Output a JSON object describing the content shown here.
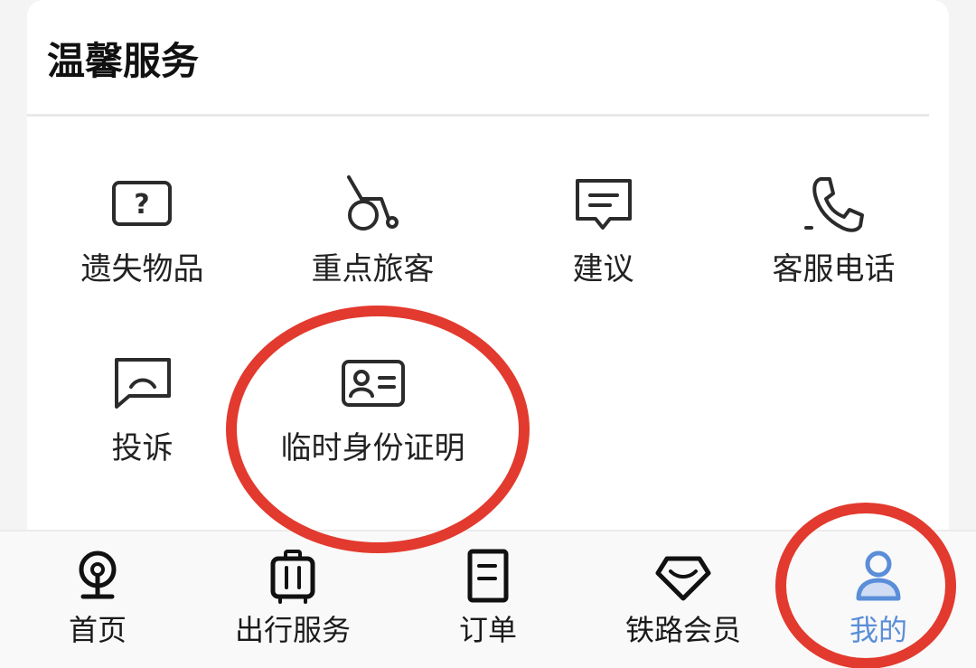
{
  "section": {
    "title": "温馨服务"
  },
  "services": [
    {
      "label": "遗失物品",
      "icon": "lost-item-icon"
    },
    {
      "label": "重点旅客",
      "icon": "wheelchair-icon"
    },
    {
      "label": "建议",
      "icon": "suggestion-icon"
    },
    {
      "label": "客服电话",
      "icon": "phone-icon"
    },
    {
      "label": "投诉",
      "icon": "complaint-icon"
    },
    {
      "label": "临时身份证明",
      "icon": "id-card-icon"
    }
  ],
  "tabs": [
    {
      "label": "首页",
      "icon": "railway-logo-icon"
    },
    {
      "label": "出行服务",
      "icon": "luggage-icon"
    },
    {
      "label": "订单",
      "icon": "order-icon"
    },
    {
      "label": "铁路会员",
      "icon": "diamond-icon"
    },
    {
      "label": "我的",
      "icon": "user-icon",
      "active": true
    }
  ],
  "colors": {
    "active_tab": "#5b8ed8",
    "highlight_ring": "#e23a2e",
    "icon_stroke": "#2b2b2b"
  }
}
